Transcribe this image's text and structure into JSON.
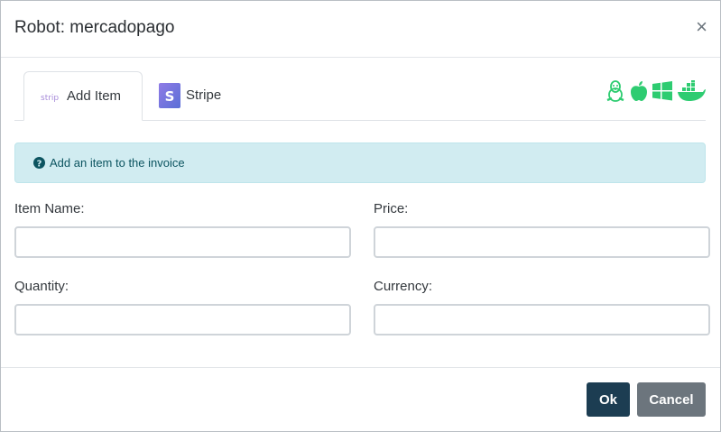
{
  "window": {
    "title": "Robot: mercadopago",
    "close_symbol": "×"
  },
  "tabs": [
    {
      "label": "Add Item",
      "icon": "stripe-wordmark-icon",
      "icon_text": "stripe",
      "active": true
    },
    {
      "label": "Stripe",
      "icon": "stripe-s-icon",
      "icon_text": "S",
      "active": false
    }
  ],
  "os_icons": [
    "linux-icon",
    "apple-icon",
    "windows-icon",
    "docker-icon"
  ],
  "alert": {
    "text": "Add an item to the invoice",
    "icon": "question-circle-icon"
  },
  "form": {
    "item_name_label": "Item Name:",
    "price_label": "Price:",
    "quantity_label": "Quantity:",
    "currency_label": "Currency:",
    "item_name_value": "",
    "price_value": "",
    "quantity_value": "",
    "currency_value": ""
  },
  "footer": {
    "ok_label": "Ok",
    "cancel_label": "Cancel"
  },
  "colors": {
    "os_icon": "#2ecc71",
    "alert_bg": "#d1ecf1",
    "ok_button": "#1c3d52",
    "cancel_button": "#6c757d"
  }
}
